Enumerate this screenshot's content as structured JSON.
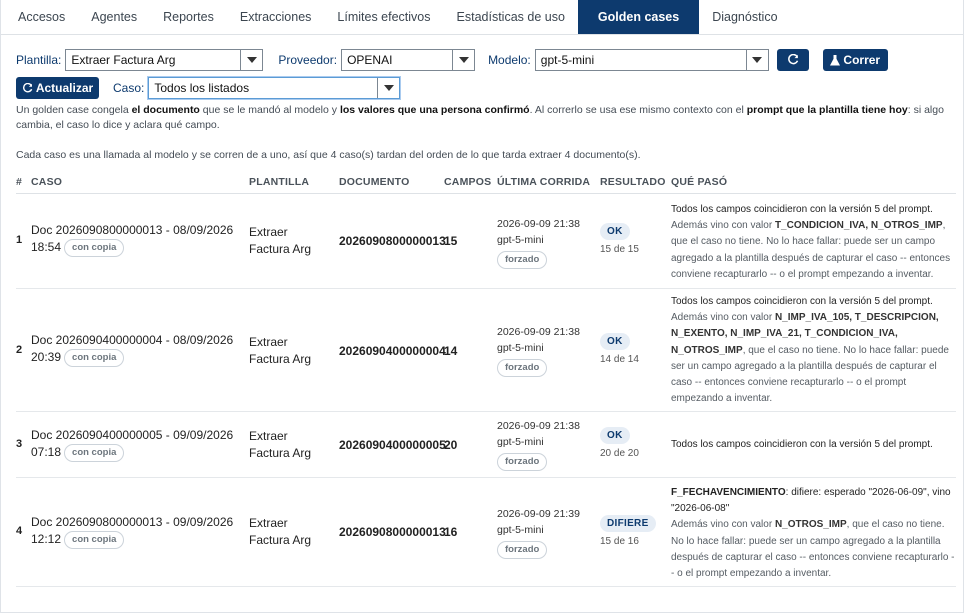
{
  "tabs": [
    {
      "label": "Accesos",
      "active": false
    },
    {
      "label": "Agentes",
      "active": false
    },
    {
      "label": "Reportes",
      "active": false
    },
    {
      "label": "Extracciones",
      "active": false
    },
    {
      "label": "Límites efectivos",
      "active": false
    },
    {
      "label": "Estadísticas de uso",
      "active": false
    },
    {
      "label": "Golden cases",
      "active": true
    },
    {
      "label": "Diagnóstico",
      "active": false
    }
  ],
  "filters": {
    "plantilla_label": "Plantilla:",
    "plantilla_value": "Extraer Factura Arg",
    "proveedor_label": "Proveedor:",
    "proveedor_value": "OPENAI",
    "modelo_label": "Modelo:",
    "modelo_value": "gpt-5-mini",
    "correr_label": "Correr",
    "actualizar_label": "Actualizar",
    "caso_label": "Caso:",
    "caso_value": "Todos los listados"
  },
  "description": {
    "p1_a": "Un golden case congela ",
    "p1_b": "el documento",
    "p1_c": " que se le mandó al modelo y ",
    "p1_d": "los valores que una persona confirmó",
    "p1_e": ". Al correrlo se usa ese mismo contexto con el ",
    "p1_f": "prompt que la plantilla tiene hoy",
    "p1_g": ": si algo cambia, el caso lo dice y aclara qué campo.",
    "p2": "Cada caso es una llamada al modelo y se corren de a uno, así que 4 caso(s) tardan del orden de lo que tarda extraer 4 documento(s)."
  },
  "table": {
    "headers": [
      "#",
      "CASO",
      "PLANTILLA",
      "DOCUMENTO",
      "CAMPOS",
      "ÚLTIMA CORRIDA",
      "RESULTADO",
      "QUÉ PASÓ"
    ],
    "rows": [
      {
        "num": "1",
        "caso_line1": "Doc 2026090800000013 - 08/09/2026",
        "caso_line2": "18:54",
        "chip": "con copia",
        "plantilla": "Extraer Factura Arg",
        "documento": "2026090800000013",
        "campos": "15",
        "run_date": "2026-09-09 21:38",
        "run_model": "gpt-5-mini",
        "run_chip": "forzado",
        "result": "OK",
        "result_sub": "15 de 15",
        "what_main": "Todos los campos coincidieron con la versión 5 del prompt.",
        "what_a": "Además vino con valor ",
        "what_fields": "T_CONDICION_IVA, N_OTROS_IMP",
        "what_b": ", que el caso no tiene. No lo hace fallar: puede ser un campo agregado a la plantilla después de capturar el caso -- entonces conviene recapturarlo -- o el prompt empezando a inventar."
      },
      {
        "num": "2",
        "caso_line1": "Doc 2026090400000004 - 08/09/2026",
        "caso_line2": "20:39",
        "chip": "con copia",
        "plantilla": "Extraer Factura Arg",
        "documento": "2026090400000004",
        "campos": "14",
        "run_date": "2026-09-09 21:38",
        "run_model": "gpt-5-mini",
        "run_chip": "forzado",
        "result": "OK",
        "result_sub": "14 de 14",
        "what_main": "Todos los campos coincidieron con la versión 5 del prompt.",
        "what_a": "Además vino con valor ",
        "what_fields": "N_IMP_IVA_105, T_DESCRIPCION, N_EXENTO, N_IMP_IVA_21, T_CONDICION_IVA, N_OTROS_IMP",
        "what_b": ", que el caso no tiene. No lo hace fallar: puede ser un campo agregado a la plantilla después de capturar el caso -- entonces conviene recapturarlo -- o el prompt empezando a inventar."
      },
      {
        "num": "3",
        "caso_line1": "Doc 2026090400000005 - 09/09/2026",
        "caso_line2": "07:18",
        "chip": "con copia",
        "plantilla": "Extraer Factura Arg",
        "documento": "2026090400000005",
        "campos": "20",
        "run_date": "2026-09-09 21:38",
        "run_model": "gpt-5-mini",
        "run_chip": "forzado",
        "result": "OK",
        "result_sub": "20 de 20",
        "what_main": "Todos los campos coincidieron con la versión 5 del prompt."
      },
      {
        "num": "4",
        "caso_line1": "Doc 2026090800000013 - 09/09/2026",
        "caso_line2": "12:12",
        "chip": "con copia",
        "plantilla": "Extraer Factura Arg",
        "documento": "2026090800000013",
        "campos": "16",
        "run_date": "2026-09-09 21:39",
        "run_model": "gpt-5-mini",
        "run_chip": "forzado",
        "result": "DIFIERE",
        "result_sub": "15 de 16",
        "what_diff_field": "F_FECHAVENCIMIENTO",
        "what_diff_text": ": difiere: esperado \"2026-06-09\", vino \"2026-06-08\"",
        "what_a": "Además vino con valor ",
        "what_fields": "N_OTROS_IMP",
        "what_b": ", que el caso no tiene. No lo hace fallar: puede ser un campo agregado a la plantilla después de capturar el caso -- entonces conviene recapturarlo -- o el prompt empezando a inventar."
      }
    ]
  }
}
